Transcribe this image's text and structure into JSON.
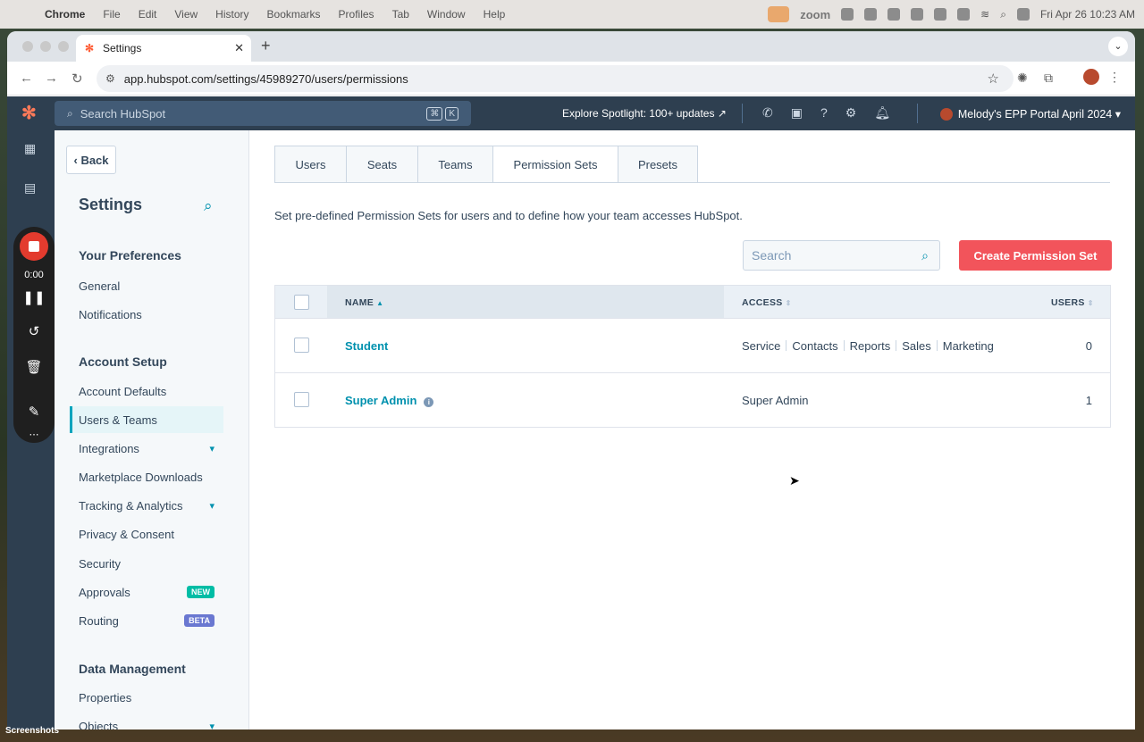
{
  "menubar": {
    "app": "Chrome",
    "items": [
      "File",
      "Edit",
      "View",
      "History",
      "Bookmarks",
      "Profiles",
      "Tab",
      "Window",
      "Help"
    ],
    "zoom_label": "zoom",
    "clock": "Fri Apr 26  10:23 AM"
  },
  "browser": {
    "tab_title": "Settings",
    "url": "app.hubspot.com/settings/45989270/users/permissions"
  },
  "hubspot_nav": {
    "search_placeholder": "Search HubSpot",
    "kbd_1": "⌘",
    "kbd_2": "K",
    "spotlight": "Explore Spotlight: 100+ updates",
    "portal": "Melody's EPP Portal April 2024"
  },
  "recorder": {
    "time": "0:00"
  },
  "sidebar": {
    "back_label": "Back",
    "title": "Settings",
    "sections": {
      "preferences": "Your Preferences",
      "account_setup": "Account Setup",
      "data_management": "Data Management"
    },
    "items": {
      "general": "General",
      "notifications": "Notifications",
      "account_defaults": "Account Defaults",
      "users_teams": "Users & Teams",
      "integrations": "Integrations",
      "marketplace": "Marketplace Downloads",
      "tracking": "Tracking & Analytics",
      "privacy": "Privacy & Consent",
      "security": "Security",
      "approvals": "Approvals",
      "routing": "Routing",
      "properties": "Properties",
      "objects": "Objects"
    },
    "badges": {
      "approvals": "NEW",
      "routing": "BETA"
    }
  },
  "main": {
    "tabs": [
      "Users",
      "Seats",
      "Teams",
      "Permission Sets",
      "Presets"
    ],
    "active_tab": "Permission Sets",
    "description": "Set pre-defined Permission Sets for users and to define how your team accesses HubSpot.",
    "search_placeholder": "Search",
    "create_button": "Create Permission Set",
    "table": {
      "columns": {
        "name": "NAME",
        "access": "ACCESS",
        "users": "USERS"
      },
      "rows": [
        {
          "name": "Student",
          "access": [
            "Service",
            "Contacts",
            "Reports",
            "Sales",
            "Marketing"
          ],
          "users": "0"
        },
        {
          "name": "Super Admin",
          "access": [
            "Super Admin"
          ],
          "users": "1"
        }
      ]
    }
  },
  "desktop_label": "Screenshots",
  "colors": {
    "hubspot_nav": "#2e3f50",
    "accent": "#0091ae",
    "primary_button": "#f2545b",
    "badge_new": "#00bda5",
    "badge_beta": "#6a78d1"
  }
}
